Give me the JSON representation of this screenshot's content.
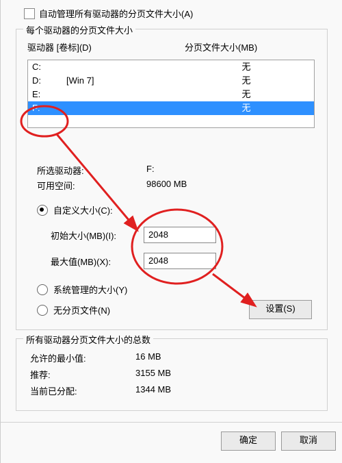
{
  "auto_manage": {
    "label": "自动管理所有驱动器的分页文件大小(A)",
    "checked": false
  },
  "group1": {
    "title": "每个驱动器的分页文件大小",
    "header": {
      "drive": "驱动器 [卷标](D)",
      "paging": "分页文件大小(MB)"
    },
    "rows": [
      {
        "letter": "C:",
        "label": "",
        "paging": "无",
        "selected": false
      },
      {
        "letter": "D:",
        "label": "[Win 7]",
        "paging": "无",
        "selected": false
      },
      {
        "letter": "E:",
        "label": "",
        "paging": "无",
        "selected": false
      },
      {
        "letter": "F:",
        "label": "",
        "paging": "无",
        "selected": true
      }
    ],
    "selected_drive": {
      "label": "所选驱动器:",
      "value": "F:"
    },
    "free_space": {
      "label": "可用空间:",
      "value": "98600 MB"
    },
    "radio_custom": {
      "label": "自定义大小(C):",
      "checked": true
    },
    "initial": {
      "label": "初始大小(MB)(I):",
      "value": "2048"
    },
    "maximum": {
      "label": "最大值(MB)(X):",
      "value": "2048"
    },
    "radio_system": {
      "label": "系统管理的大小(Y)",
      "checked": false
    },
    "radio_none": {
      "label": "无分页文件(N)",
      "checked": false
    },
    "set_button": "设置(S)"
  },
  "group2": {
    "title": "所有驱动器分页文件大小的总数",
    "min": {
      "label": "允许的最小值:",
      "value": "16 MB"
    },
    "rec": {
      "label": "推荐:",
      "value": "3155 MB"
    },
    "cur": {
      "label": "当前已分配:",
      "value": "1344 MB"
    }
  },
  "buttons": {
    "ok": "确定",
    "cancel": "取消"
  },
  "annotation_color": "#e02020"
}
